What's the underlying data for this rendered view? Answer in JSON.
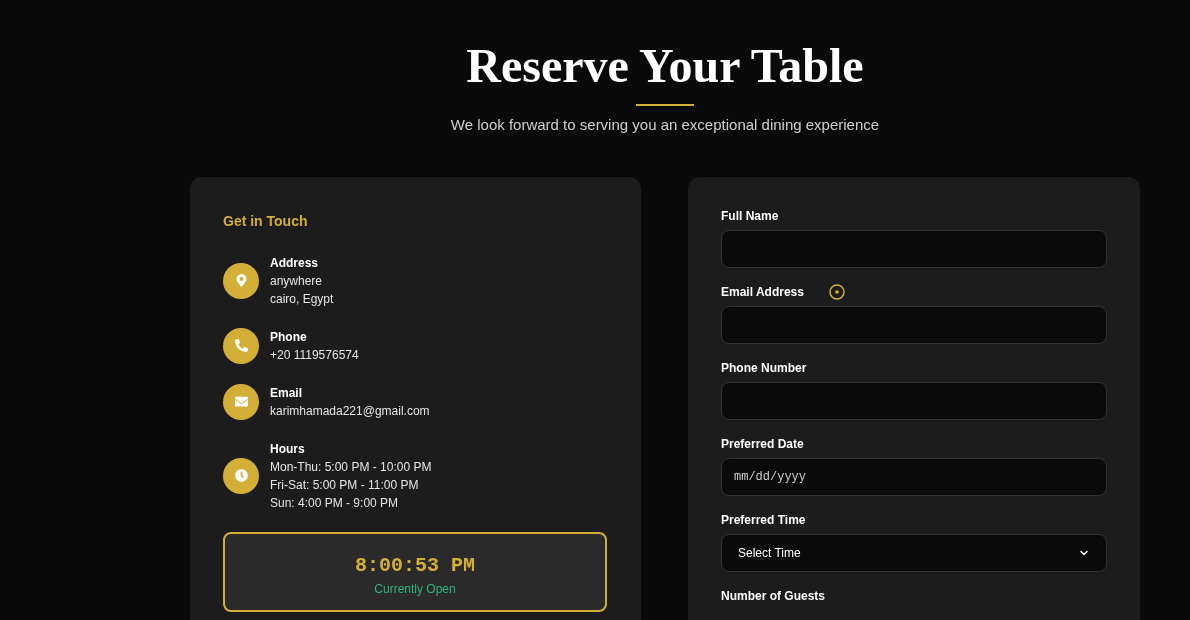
{
  "header": {
    "title": "Reserve Your Table",
    "subtitle": "We look forward to serving you an exceptional dining experience"
  },
  "contact": {
    "heading": "Get in Touch",
    "items": [
      {
        "kind": "address",
        "label": "Address",
        "lines": [
          "anywhere",
          "cairo, Egypt"
        ]
      },
      {
        "kind": "phone",
        "label": "Phone",
        "lines": [
          "+20 1119576574"
        ]
      },
      {
        "kind": "email",
        "label": "Email",
        "lines": [
          "karimhamada221@gmail.com"
        ]
      },
      {
        "kind": "hours",
        "label": "Hours",
        "lines": [
          "Mon-Thu: 5:00 PM - 10:00 PM",
          "Fri-Sat: 5:00 PM - 11:00 PM",
          "Sun: 4:00 PM - 9:00 PM"
        ]
      }
    ],
    "clock": {
      "time": "8:00:53 PM",
      "status": "Currently Open",
      "open": true
    }
  },
  "form": {
    "fields": [
      {
        "kind": "text",
        "label": "Full Name"
      },
      {
        "kind": "email",
        "label": "Email Address"
      },
      {
        "kind": "tel",
        "label": "Phone Number"
      },
      {
        "kind": "date",
        "label": "Preferred Date",
        "placeholder": "mm/dd/yyyy"
      },
      {
        "kind": "select",
        "label": "Preferred Time",
        "value": "Select Time"
      },
      {
        "kind": "label",
        "label": "Number of Guests"
      }
    ]
  }
}
